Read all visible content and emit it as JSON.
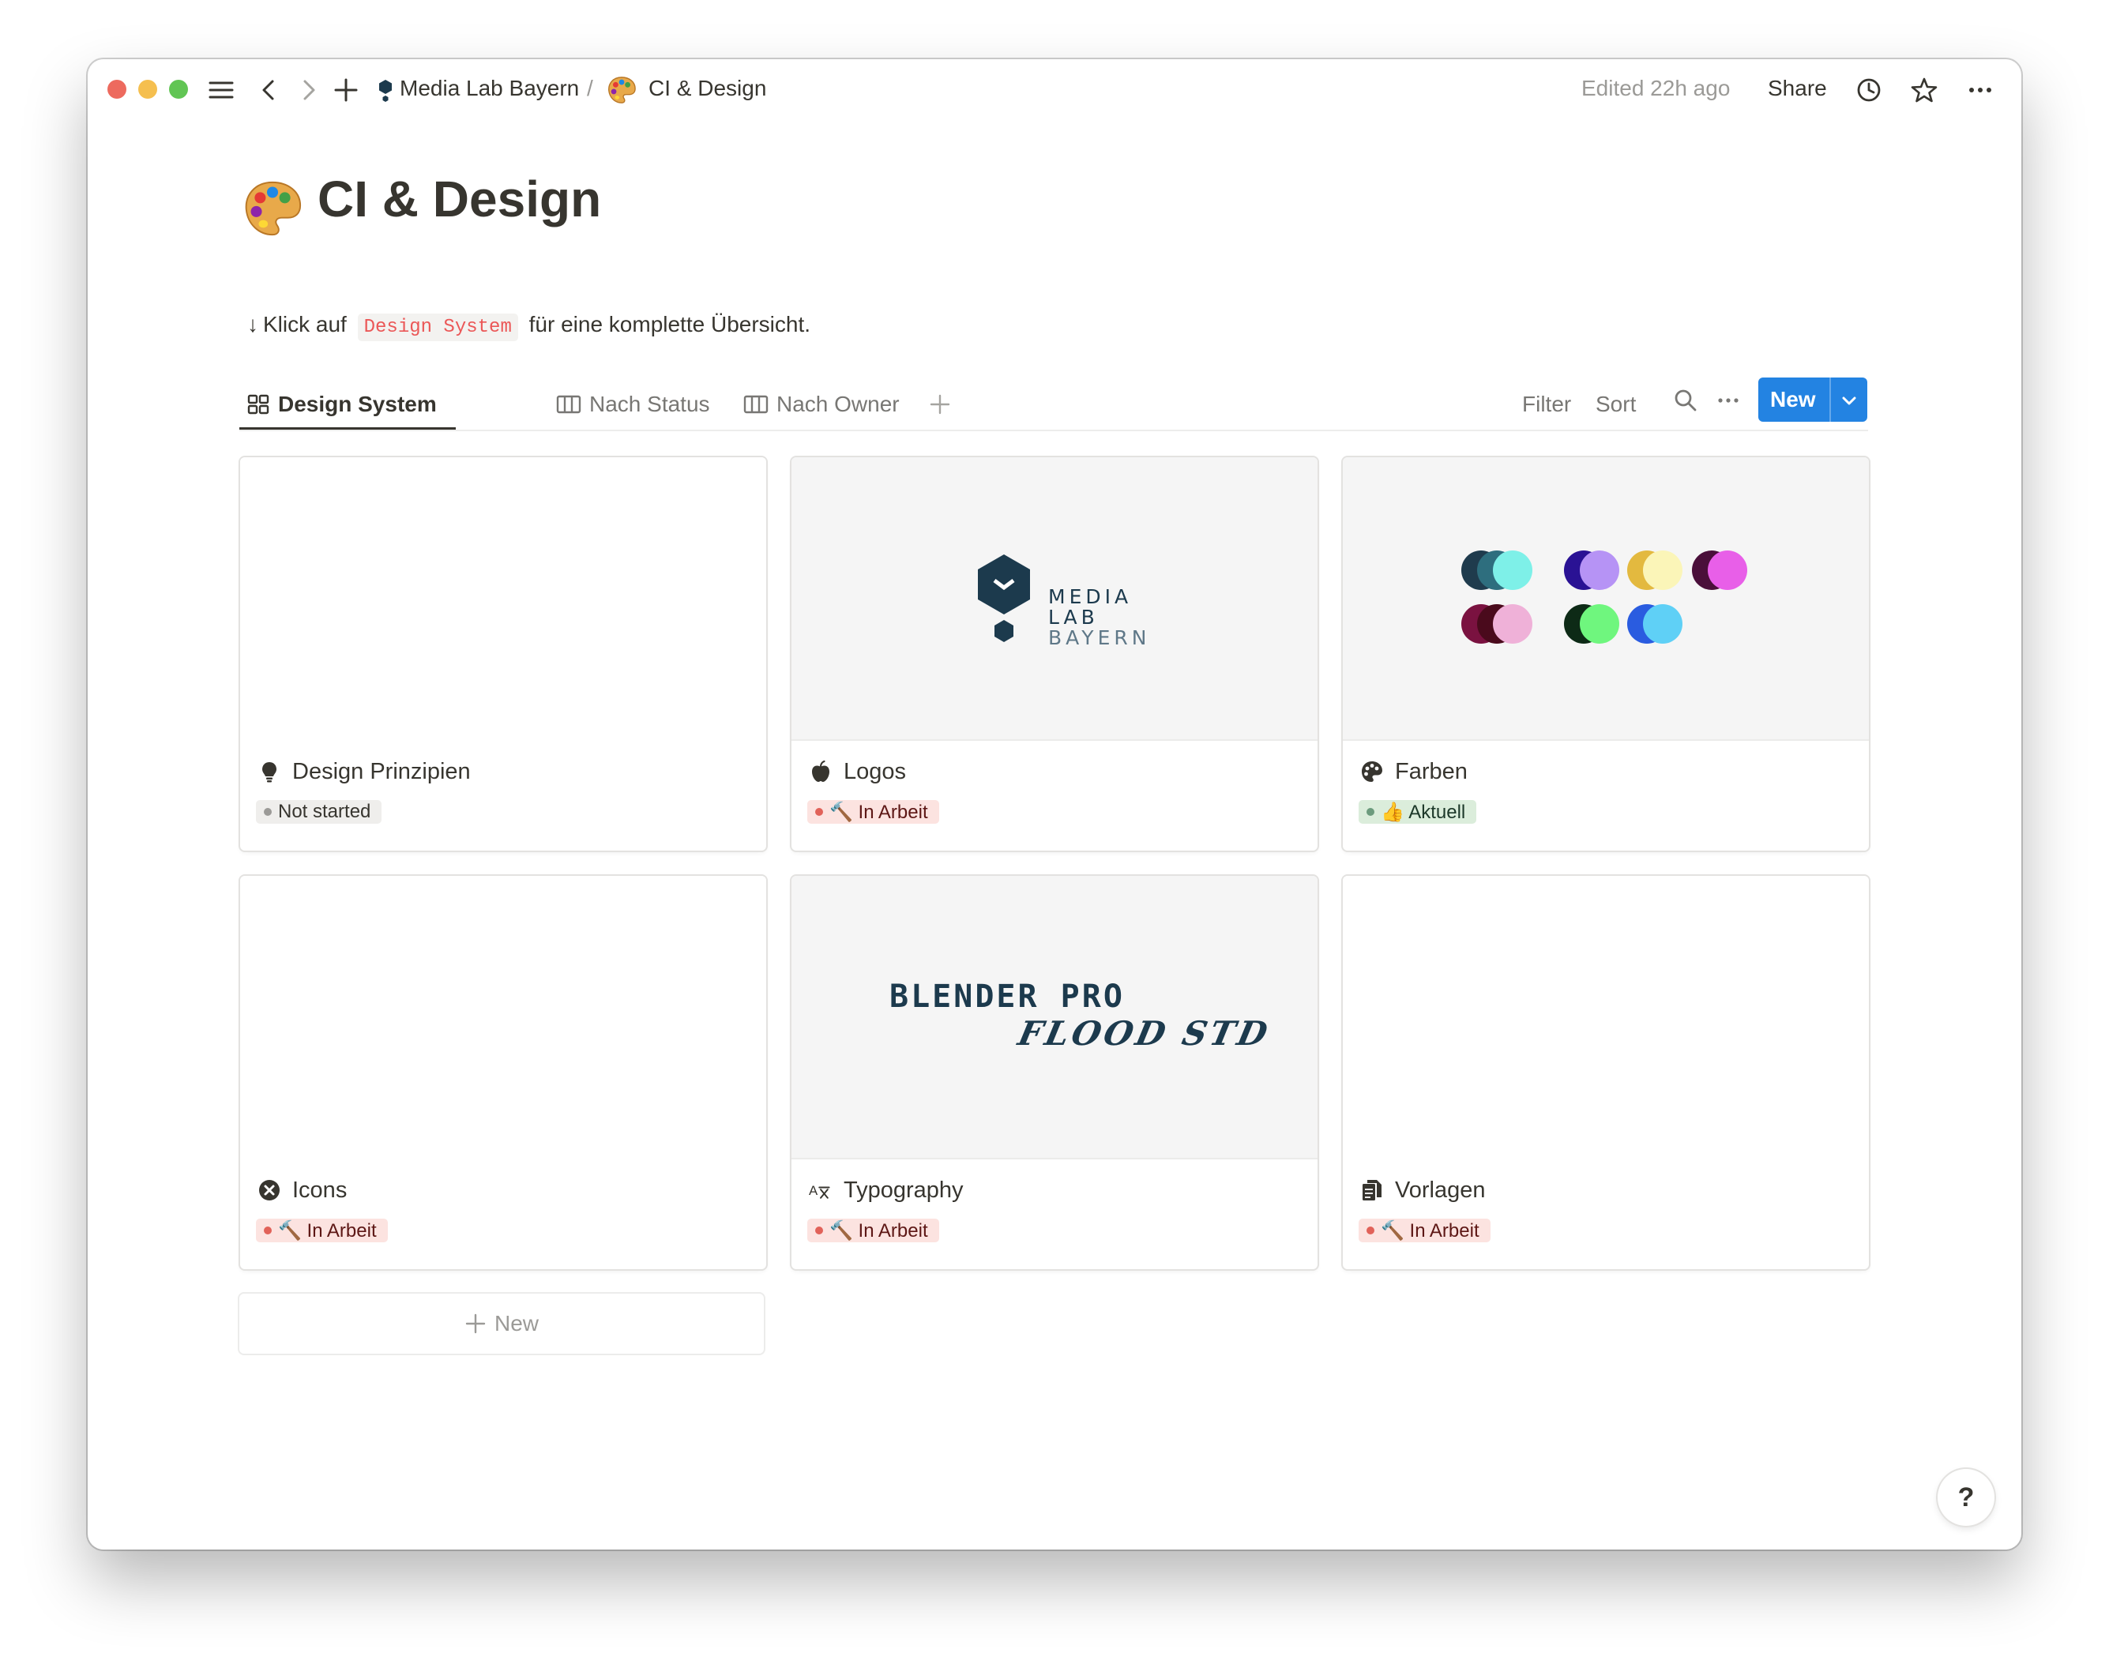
{
  "topbar": {
    "breadcrumb_workspace": "Media Lab Bayern",
    "breadcrumb_separator": "/",
    "breadcrumb_page": "CI & Design",
    "edited": "Edited 22h ago",
    "share": "Share"
  },
  "page": {
    "title": "CI & Design",
    "hint_prefix": "Klick auf",
    "hint_code": "Design System",
    "hint_suffix": "für eine komplette Übersicht."
  },
  "views": {
    "tabs": [
      {
        "label": "Design System",
        "active": true
      },
      {
        "label": "Nach Status",
        "active": false
      },
      {
        "label": "Nach Owner",
        "active": false
      }
    ],
    "filter": "Filter",
    "sort": "Sort",
    "new_button": "New"
  },
  "cards": [
    {
      "title": "Design Prinzipien",
      "icon": "lightbulb-icon",
      "status": "Not started",
      "status_color": "grey"
    },
    {
      "title": "Logos",
      "icon": "apple-icon",
      "status": "🔨 In Arbeit",
      "status_color": "red",
      "cover_text": [
        "MEDIA",
        "LAB",
        "BAYERN"
      ]
    },
    {
      "title": "Farben",
      "icon": "palette-icon",
      "status": "👍 Aktuell",
      "status_color": "green"
    },
    {
      "title": "Icons",
      "icon": "close-circle-icon",
      "status": "🔨 In Arbeit",
      "status_color": "red"
    },
    {
      "title": "Typography",
      "icon": "typography-icon",
      "status": "🔨 In Arbeit",
      "status_color": "red",
      "cover_text": [
        "BLENDER PRO",
        "FLOOD STD"
      ]
    },
    {
      "title": "Vorlagen",
      "icon": "documents-icon",
      "status": "🔨 In Arbeit",
      "status_color": "red"
    }
  ],
  "add_new": "New",
  "help": "?",
  "colors": {
    "accent": "#2383e2",
    "logo_navy": "#1c3a4d",
    "swatches": [
      "#1f3b4d",
      "#2e6e7e",
      "#7ef0e8",
      "#2a1294",
      "#b693f5",
      "#e3b93f",
      "#fbf5b8",
      "#4a0f3a",
      "#e85fe8",
      "#7a1240",
      "#4a0a1c",
      "#efb1d8",
      "#0d2a16",
      "#6ff67e",
      "#2a5ce0",
      "#5fd0f6"
    ]
  }
}
